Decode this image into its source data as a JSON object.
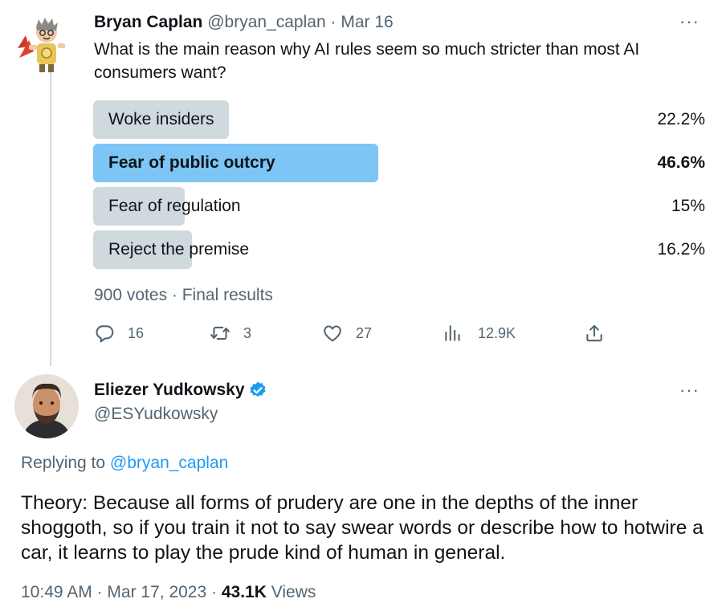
{
  "original_tweet": {
    "author_name": "Bryan Caplan",
    "author_handle": "@bryan_caplan",
    "separator": "·",
    "date": "Mar 16",
    "more": "···",
    "question": "What is the main reason why AI rules seem so much stricter than most AI consumers want?",
    "poll": {
      "options": [
        {
          "label": "Woke insiders",
          "percent_text": "22.2%",
          "percent": 22.2,
          "winner": false
        },
        {
          "label": "Fear of public outcry",
          "percent_text": "46.6%",
          "percent": 46.6,
          "winner": true
        },
        {
          "label": "Fear of regulation",
          "percent_text": "15%",
          "percent": 15,
          "winner": false
        },
        {
          "label": "Reject the premise",
          "percent_text": "16.2%",
          "percent": 16.2,
          "winner": false
        }
      ],
      "summary": "900 votes · Final results",
      "colors": {
        "bar": "#cfd9de",
        "winner_bar": "#7cc5f5"
      }
    },
    "actions": {
      "replies": "16",
      "retweets": "3",
      "likes": "27",
      "views": "12.9K"
    }
  },
  "reply_tweet": {
    "author_name": "Eliezer Yudkowsky",
    "author_handle": "@ESYudkowsky",
    "verified": true,
    "more": "···",
    "replying_to_prefix": "Replying to",
    "replying_to_handle": "@bryan_caplan",
    "text": "Theory:  Because all forms of prudery are one in the depths of the inner shoggoth, so if you train it not to say swear words or describe how to hotwire a car, it learns to play the prude kind of human in general.",
    "time": "10:49 AM",
    "date": "Mar 17, 2023",
    "views_count": "43.1K",
    "views_label": "Views",
    "separator": "·"
  },
  "colors": {
    "accent": "#1d9bf0",
    "muted": "#536471",
    "text": "#0f1419",
    "thread_line": "#cfd9de"
  }
}
